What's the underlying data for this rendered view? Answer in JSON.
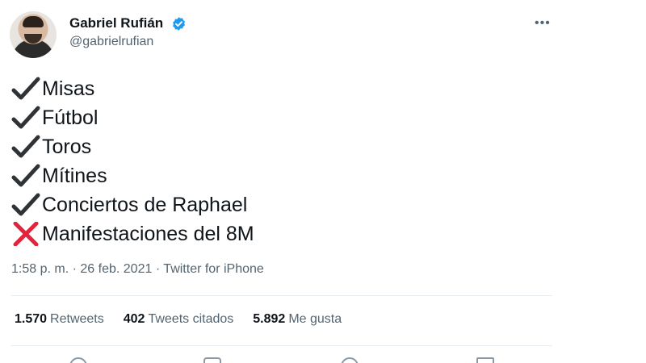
{
  "author": {
    "name": "Gabriel Rufián",
    "handle": "@gabrielrufian",
    "verified": true
  },
  "menu": {
    "more_label": "•••"
  },
  "tweet": {
    "lines": [
      {
        "icon": "check-icon",
        "text": "Misas"
      },
      {
        "icon": "check-icon",
        "text": "Fútbol"
      },
      {
        "icon": "check-icon",
        "text": "Toros"
      },
      {
        "icon": "check-icon",
        "text": "Mítines"
      },
      {
        "icon": "check-icon",
        "text": "Conciertos de Raphael"
      },
      {
        "icon": "cross-icon",
        "text": "Manifestaciones del 8M"
      }
    ],
    "time": "1:58 p. m.",
    "separator": "·",
    "date": "26 feb. 2021",
    "source": "Twitter for iPhone"
  },
  "stats": {
    "retweets": {
      "count": "1.570",
      "label": "Retweets"
    },
    "quotes": {
      "count": "402",
      "label": "Tweets citados"
    },
    "likes": {
      "count": "5.892",
      "label": "Me gusta"
    }
  },
  "colors": {
    "text": "#0f1419",
    "secondary": "#536471",
    "verified": "#1d9bf0",
    "check": "#2f3336",
    "cross": "#e1243b",
    "divider": "#e6ecf0"
  }
}
